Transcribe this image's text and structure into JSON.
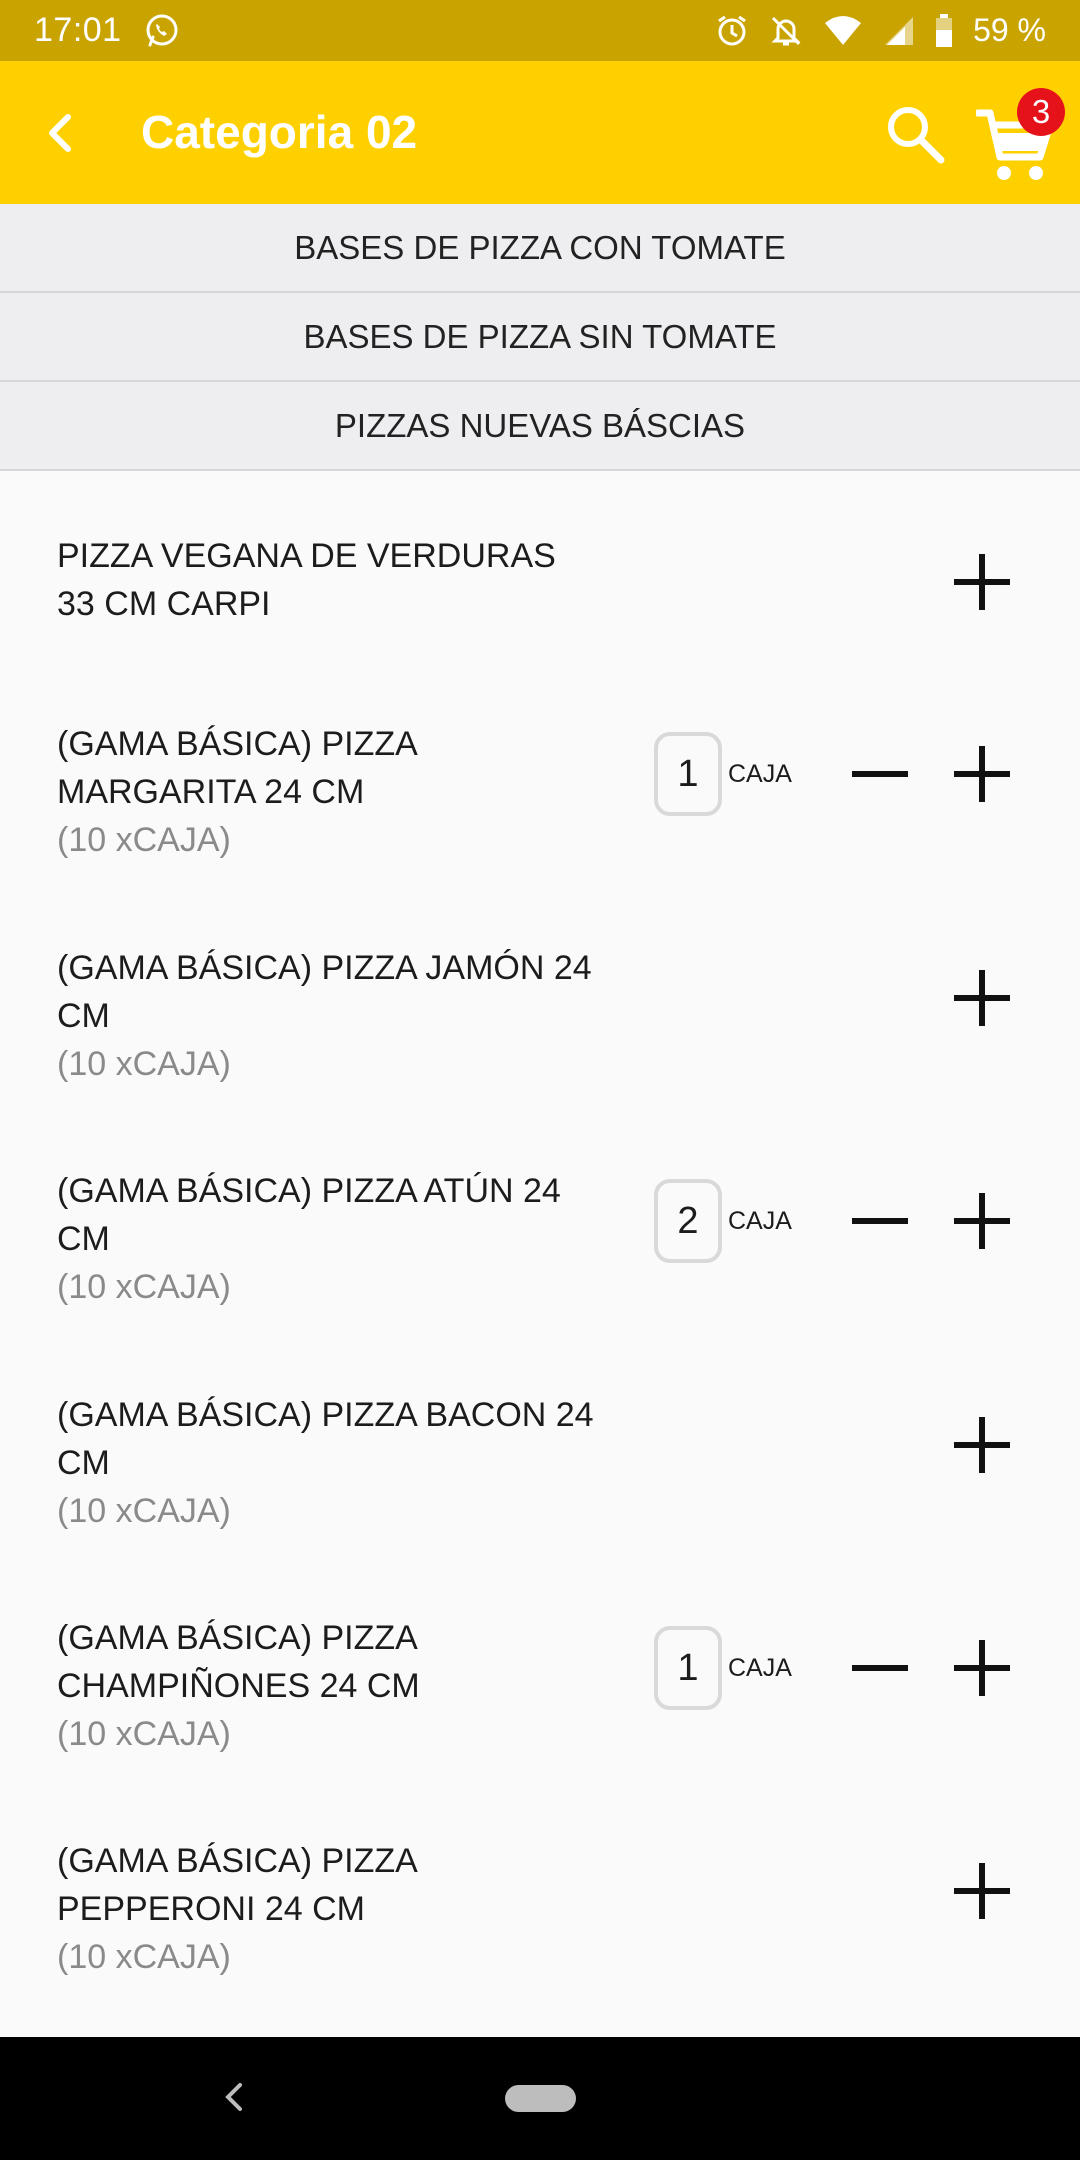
{
  "status_bar": {
    "time": "17:01",
    "battery": "59 %",
    "icons": [
      "whatsapp-icon",
      "alarm-icon",
      "notifications-off-icon",
      "wifi-icon",
      "signal-icon",
      "battery-icon"
    ]
  },
  "app_bar": {
    "title": "Categoria 02",
    "cart_count": "3",
    "icons": [
      "back-arrow-icon",
      "search-icon",
      "cart-icon"
    ]
  },
  "subcategories": [
    "BASES DE PIZZA CON TOMATE",
    "BASES DE PIZZA SIN TOMATE",
    "PIZZAS NUEVAS BÁSCIAS"
  ],
  "products": [
    {
      "name": "PIZZA VEGANA DE VERDURAS 33 CM CARPI",
      "unit": "",
      "qty": "",
      "qty_unit": ""
    },
    {
      "name": "(GAMA BÁSICA) PIZZA MARGARITA 24 CM",
      "unit": "(10 xCAJA)",
      "qty": "1",
      "qty_unit": "CAJA"
    },
    {
      "name": "(GAMA BÁSICA) PIZZA JAMÓN 24 CM",
      "unit": "(10 xCAJA)",
      "qty": "",
      "qty_unit": ""
    },
    {
      "name": "(GAMA BÁSICA) PIZZA ATÚN 24 CM",
      "unit": "(10 xCAJA)",
      "qty": "2",
      "qty_unit": "CAJA"
    },
    {
      "name": "(GAMA BÁSICA) PIZZA BACON 24 CM",
      "unit": "(10 xCAJA)",
      "qty": "",
      "qty_unit": ""
    },
    {
      "name": "(GAMA BÁSICA) PIZZA CHAMPIÑONES 24 CM",
      "unit": "(10 xCAJA)",
      "qty": "1",
      "qty_unit": "CAJA"
    },
    {
      "name": "(GAMA BÁSICA) PIZZA PEPPERONI 24 CM",
      "unit": "(10 xCAJA)",
      "qty": "",
      "qty_unit": ""
    }
  ],
  "colors": {
    "status_bar": "#c9a300",
    "app_bar": "#ffd000",
    "badge": "#e6121a"
  }
}
